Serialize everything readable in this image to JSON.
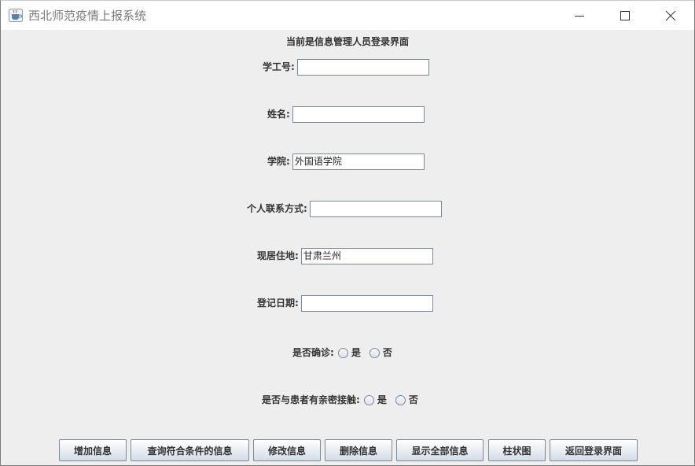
{
  "window": {
    "title": "西北师范疫情上报系统",
    "icons": {
      "app": "java-cup-icon",
      "minimize": "minimize-icon",
      "maximize": "maximize-icon",
      "close": "close-icon"
    }
  },
  "form": {
    "heading": "当前是信息管理人员登录界面",
    "fields": {
      "id": {
        "label": "学工号:",
        "value": ""
      },
      "name": {
        "label": "姓名:",
        "value": ""
      },
      "college": {
        "label": "学院:",
        "value": "外国语学院"
      },
      "contact": {
        "label": "个人联系方式:",
        "value": ""
      },
      "residence": {
        "label": "现居住地:",
        "value": "甘肃兰州"
      },
      "date": {
        "label": "登记日期:",
        "value": ""
      }
    },
    "diagnosed": {
      "label": "是否确诊:",
      "yes": "是",
      "no": "否"
    },
    "contact_with_patient": {
      "label": "是否与患者有亲密接触:",
      "yes": "是",
      "no": "否"
    }
  },
  "buttons": {
    "add": "增加信息",
    "query": "查询符合条件的信息",
    "edit": "修改信息",
    "delete": "删除信息",
    "show_all": "显示全部信息",
    "chart": "柱状图",
    "back": "返回登录界面"
  }
}
